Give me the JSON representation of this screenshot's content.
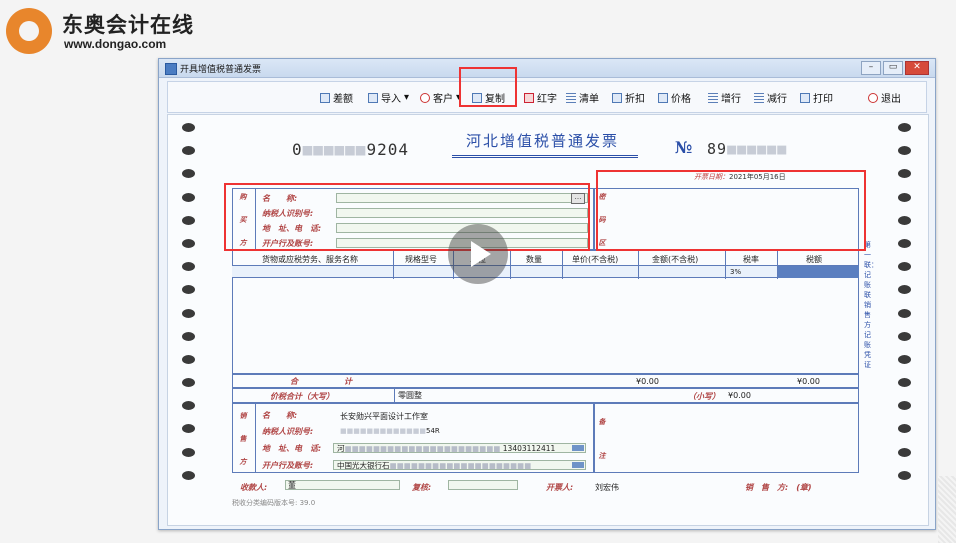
{
  "logo": {
    "cn": "东奥会计在线",
    "url": "www.dongao.com"
  },
  "window": {
    "title": "开具增值税普通发票"
  },
  "toolbar": {
    "items": [
      {
        "label": "差额",
        "icon": "grid-icon"
      },
      {
        "label": "导入",
        "icon": "import-icon"
      },
      {
        "label": "客户",
        "icon": "customer-icon"
      },
      {
        "label": "复制",
        "icon": "copy-icon"
      },
      {
        "label": "红字",
        "icon": "red-invoice-icon"
      },
      {
        "label": "清单",
        "icon": "list-icon"
      },
      {
        "label": "折扣",
        "icon": "discount-icon"
      },
      {
        "label": "价格",
        "icon": "price-icon"
      },
      {
        "label": "增行",
        "icon": "add-row-icon"
      },
      {
        "label": "减行",
        "icon": "remove-row-icon"
      },
      {
        "label": "打印",
        "icon": "print-icon"
      },
      {
        "label": "退出",
        "icon": "exit-icon"
      }
    ]
  },
  "invoice": {
    "code_prefix": "0",
    "code_suffix": "9204",
    "title": "河北增值税普通发票",
    "no_label": "№",
    "no_prefix": "89",
    "no_suffix": "",
    "date_label": "开票日期：",
    "date": "2021年05月16日",
    "buyer": {
      "side_label": [
        "购",
        "买",
        "方"
      ],
      "name_label": "名　　称:",
      "tax_label": "纳税人识别号:",
      "addr_label": "地　址、电　话:",
      "bank_label": "开户行及账号:"
    },
    "password_label": [
      "密",
      "码",
      "区"
    ],
    "columns": [
      "货物或应税劳务、服务名称",
      "规格型号",
      "单位",
      "数量",
      "单价(不含税)",
      "金额(不含税)",
      "税率",
      "税额"
    ],
    "rate_value": "3%",
    "total_label": "合　　计",
    "total_amount": "¥0.00",
    "total_tax": "¥0.00",
    "price_tax_label": "价税合计（大写）",
    "price_tax_upper": "零圆整",
    "small_label": "（小写）",
    "small_value": "¥0.00",
    "seller": {
      "side_label": [
        "销",
        "售",
        "方"
      ],
      "name_label": "名　　称:",
      "name": "长安勋兴平面设计工作室",
      "tax_label": "纳税人识别号:",
      "tax_value": "54R",
      "addr_label": "地　址、电　话:",
      "addr_value": "河",
      "addr_phone": "13403112411",
      "bank_label": "开户行及账号:",
      "bank_value": "中国光大银行石"
    },
    "remark_label": [
      "备",
      "注"
    ],
    "side_note": "第一联：记账联　销售方记账凭证",
    "payee_label": "收款人:",
    "payee": "董",
    "reviewer_label": "复核:",
    "drawer_label": "开票人:",
    "drawer": "刘宏伟",
    "seller_stamp": "销　售　方:　(章)",
    "version": "税收分类编码版本号: 39.0"
  }
}
